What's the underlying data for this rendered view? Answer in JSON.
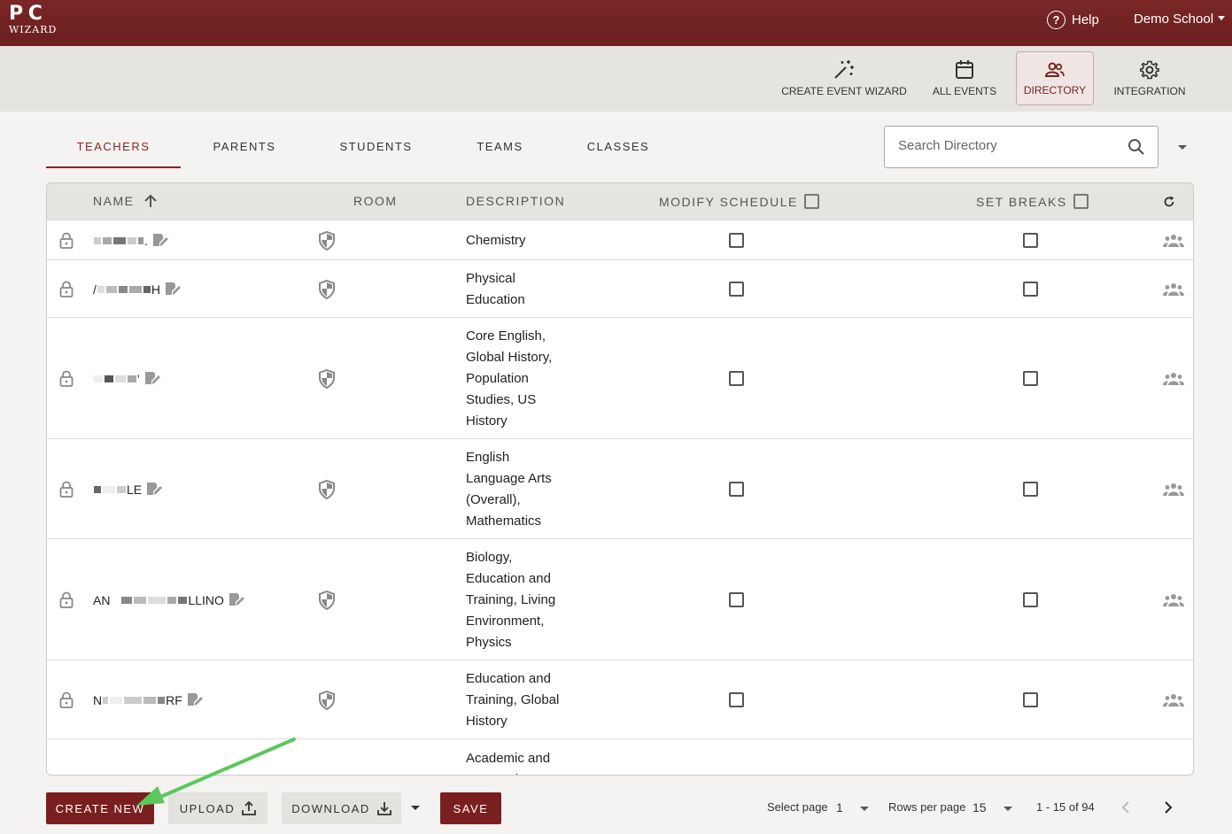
{
  "app": {
    "logo_main": "P C",
    "logo_sub": "WIZARD",
    "help_label": "Help",
    "school_label": "Demo School"
  },
  "nav": {
    "items": [
      {
        "label": "CREATE EVENT WIZARD",
        "icon": "magic-wand-icon"
      },
      {
        "label": "ALL EVENTS",
        "icon": "calendar-icon"
      },
      {
        "label": "DIRECTORY",
        "icon": "people-icon",
        "active": true
      },
      {
        "label": "INTEGRATION",
        "icon": "gear-icon"
      }
    ]
  },
  "tabs": [
    {
      "label": "TEACHERS",
      "active": true
    },
    {
      "label": "PARENTS"
    },
    {
      "label": "STUDENTS"
    },
    {
      "label": "TEAMS"
    },
    {
      "label": "CLASSES"
    }
  ],
  "search": {
    "placeholder": "Search Directory"
  },
  "table": {
    "headers": {
      "name": "NAME",
      "room": "ROOM",
      "description": "DESCRIPTION",
      "modify_schedule": "MODIFY SCHEDULE",
      "set_breaks": "SET BREAKS"
    },
    "rows": [
      {
        "name_prefix": "",
        "name_suffix": ".",
        "description": "Chemistry"
      },
      {
        "name_prefix": "/",
        "name_suffix": "H",
        "description": "Physical Education"
      },
      {
        "name_prefix": "",
        "name_suffix": "'",
        "description": "Core English, Global History, Population Studies, US History"
      },
      {
        "name_prefix": "",
        "name_suffix": "LE",
        "description": "English Language Arts (Overall), Mathematics"
      },
      {
        "name_prefix": "AN",
        "name_suffix": "LLINO",
        "description": "Biology, Education and Training, Living Environment, Physics"
      },
      {
        "name_prefix": "N",
        "name_suffix": "RF",
        "description": "Education and Training, Global History"
      },
      {
        "name_prefix": "",
        "name_suffix": "",
        "description": "Academic and Personal"
      }
    ]
  },
  "bottom": {
    "create_new": "CREATE NEW",
    "upload": "UPLOAD",
    "download": "DOWNLOAD",
    "save": "SAVE",
    "select_page_label": "Select page",
    "select_page_value": "1",
    "rows_per_page_label": "Rows per page",
    "rows_per_page_value": "15",
    "range": "1 - 15 of 94"
  },
  "colors": {
    "brand": "#7a1f1f",
    "annotation_arrow": "#5cc75a"
  }
}
